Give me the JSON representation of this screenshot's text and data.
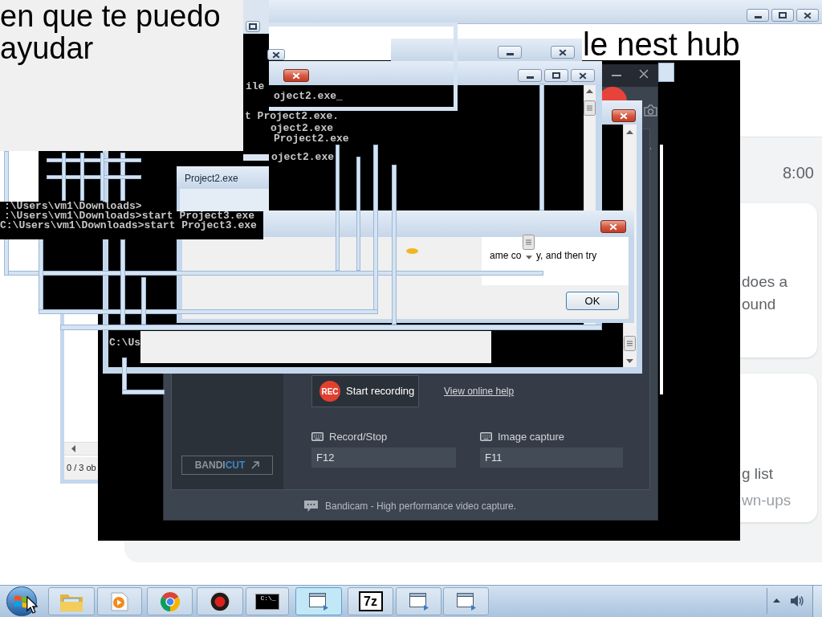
{
  "chat_panel": {
    "text": "en que te puedo ayudar"
  },
  "browser": {
    "heading": "le nest hub",
    "time": "8:00",
    "cards": [
      {
        "title": [
          "does a",
          "ound"
        ]
      },
      {
        "title": [
          "g list"
        ],
        "subtitle": "wn-ups"
      }
    ]
  },
  "console_main": {
    "lines": [
      "ile",
      "oject2.exe_",
      "t Project2.exe.",
      "oject2.exe",
      "Project2.exe",
      "oject2.exe"
    ]
  },
  "project_window": {
    "title": "Project2.exe"
  },
  "console_left": {
    "lines": [
      ":\\Users\\vm1\\Downloads>",
      ":\\Users\\vm1\\Downloads>start Project3.exe",
      "C:\\Users\\vm1\\Downloads>start Project3.exe"
    ]
  },
  "error_dialog": {
    "message": [
      "ame co",
      "y, and then try"
    ],
    "ok_button": "OK"
  },
  "console_bottom": {
    "lines": [
      "C:\\Us"
    ]
  },
  "bandicam": {
    "rec_badge": "REC",
    "record_button": "Start recording",
    "help_link": "View online help",
    "hotkeys": [
      {
        "label": "Record/Stop",
        "value": "F12"
      },
      {
        "label": "Image capture",
        "value": "F11"
      }
    ],
    "bandicut": {
      "part_1": "BANDI",
      "part_2": "CUT"
    },
    "footer": "Bandicam - High performance video capture."
  },
  "explorer": {
    "status": "0 / 3 ob"
  },
  "taskbar": {
    "items": [
      {
        "kind": "explorer",
        "selected": false
      },
      {
        "kind": "media",
        "selected": false
      },
      {
        "kind": "browser",
        "selected": false
      },
      {
        "kind": "recorder",
        "selected": false
      },
      {
        "kind": "terminal",
        "glyph": "C:\\_",
        "selected": false
      },
      {
        "kind": "window",
        "selected": true
      },
      {
        "kind": "archive",
        "glyph": "7z",
        "selected": false
      },
      {
        "kind": "window",
        "selected": false
      },
      {
        "kind": "window",
        "selected": false
      }
    ]
  }
}
